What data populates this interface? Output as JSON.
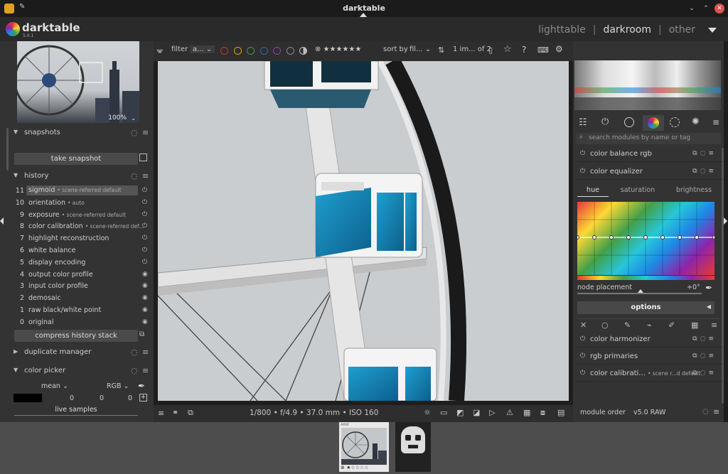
{
  "titlebar": {
    "title": "darktable"
  },
  "header": {
    "logo": "darktable",
    "logo_version": "5.0.1",
    "views": [
      "lighttable",
      "|",
      "darkroom",
      "|",
      "other"
    ]
  },
  "navigation": {
    "zoom": "100%"
  },
  "left": {
    "snapshots": {
      "label": "snapshots",
      "take_snapshot": "take snapshot"
    },
    "history": {
      "label": "history",
      "items": [
        {
          "num": "11",
          "name": "sigmoid",
          "sub": "• scene-referred default"
        },
        {
          "num": "10",
          "name": "orientation",
          "sub": "• auto"
        },
        {
          "num": "9",
          "name": "exposure",
          "sub": "• scene-referred default"
        },
        {
          "num": "8",
          "name": "color calibration",
          "sub": "• scene-referred def..."
        },
        {
          "num": "7",
          "name": "highlight reconstruction",
          "sub": ""
        },
        {
          "num": "6",
          "name": "white balance",
          "sub": ""
        },
        {
          "num": "5",
          "name": "display encoding",
          "sub": ""
        },
        {
          "num": "4",
          "name": "output color profile",
          "sub": ""
        },
        {
          "num": "3",
          "name": "input color profile",
          "sub": ""
        },
        {
          "num": "2",
          "name": "demosaic",
          "sub": ""
        },
        {
          "num": "1",
          "name": "raw black/white point",
          "sub": ""
        },
        {
          "num": "0",
          "name": "original",
          "sub": ""
        }
      ],
      "compress": "compress history stack"
    },
    "duplicate_manager": "duplicate manager",
    "color_picker": {
      "label": "color picker",
      "mode": "mean",
      "model": "RGB",
      "values": [
        "0",
        "0",
        "0"
      ],
      "live_samples": "live samples"
    }
  },
  "toolbar": {
    "filter_label": "filter",
    "filter_value": "a...",
    "sort_label": "sort by",
    "sort_value": "fil...",
    "count": "1 im... of 2",
    "color_labels": [
      "#c0392b",
      "#d4a017",
      "#3c9a3c",
      "#2f5fb0",
      "#8e44ad",
      "#888888"
    ]
  },
  "infobar": {
    "exif": "1/800 • f/4.9 • 37.0 mm • ISO 160"
  },
  "right": {
    "search_placeholder": "search modules by name or tag",
    "modules_top": [
      {
        "name": "color balance rgb",
        "sub": ""
      },
      {
        "name": "color equalizer",
        "sub": ""
      }
    ],
    "tabs": [
      "hue",
      "saturation",
      "brightness"
    ],
    "node_placement_label": "node placement",
    "node_placement_value": "+0°",
    "options": "options",
    "modules_bottom": [
      {
        "name": "color harmonizer",
        "sub": ""
      },
      {
        "name": "rgb primaries",
        "sub": ""
      },
      {
        "name": "color calibrati...",
        "sub": "• scene r...d default"
      }
    ],
    "module_order_label": "module order",
    "module_order_value": "v5.0 RAW"
  },
  "filmstrip": {
    "thumb_label": "ARW"
  }
}
